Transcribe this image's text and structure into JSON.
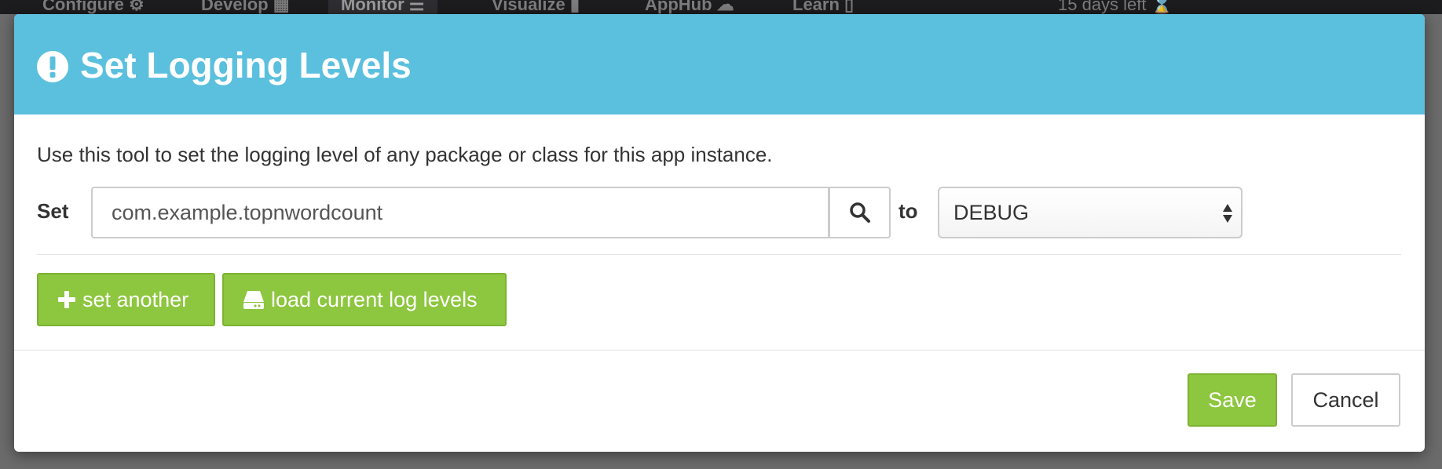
{
  "background_nav": {
    "items": [
      {
        "label": "Configure",
        "icon": "gear-icon"
      },
      {
        "label": "Develop",
        "icon": "grid-icon"
      },
      {
        "label": "Monitor",
        "icon": "server-icon"
      },
      {
        "label": "Visualize",
        "icon": "bar-chart-icon"
      },
      {
        "label": "AppHub",
        "icon": "cloud-icon"
      },
      {
        "label": "Learn",
        "icon": "book-icon"
      }
    ],
    "trial_text": "15 days left"
  },
  "modal": {
    "title": "Set Logging Levels",
    "header_icon": "exclamation-circle-icon",
    "header_color": "#5bc0de",
    "description": "Use this tool to set the logging level of any package or class for this app instance.",
    "set_label": "Set",
    "package_value": "com.example.topnwordcount",
    "to_label": "to",
    "level_selected": "DEBUG",
    "set_another_label": "set another",
    "load_levels_label": "load current log levels",
    "save_label": "Save",
    "cancel_label": "Cancel",
    "accent_green": "#8dc63f"
  }
}
